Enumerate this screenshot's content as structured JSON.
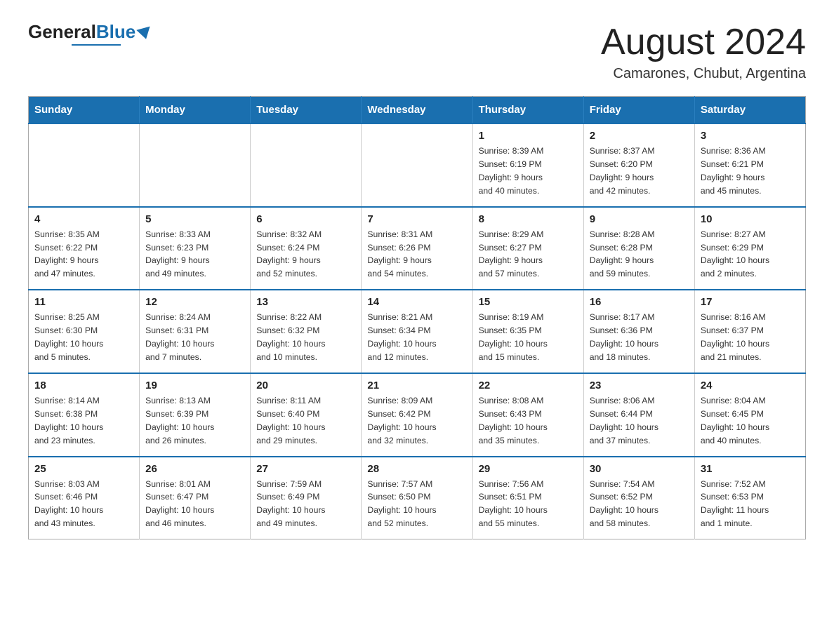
{
  "logo": {
    "general": "General",
    "blue": "Blue"
  },
  "title": "August 2024",
  "location": "Camarones, Chubut, Argentina",
  "weekdays": [
    "Sunday",
    "Monday",
    "Tuesday",
    "Wednesday",
    "Thursday",
    "Friday",
    "Saturday"
  ],
  "weeks": [
    [
      {
        "day": "",
        "info": ""
      },
      {
        "day": "",
        "info": ""
      },
      {
        "day": "",
        "info": ""
      },
      {
        "day": "",
        "info": ""
      },
      {
        "day": "1",
        "info": "Sunrise: 8:39 AM\nSunset: 6:19 PM\nDaylight: 9 hours\nand 40 minutes."
      },
      {
        "day": "2",
        "info": "Sunrise: 8:37 AM\nSunset: 6:20 PM\nDaylight: 9 hours\nand 42 minutes."
      },
      {
        "day": "3",
        "info": "Sunrise: 8:36 AM\nSunset: 6:21 PM\nDaylight: 9 hours\nand 45 minutes."
      }
    ],
    [
      {
        "day": "4",
        "info": "Sunrise: 8:35 AM\nSunset: 6:22 PM\nDaylight: 9 hours\nand 47 minutes."
      },
      {
        "day": "5",
        "info": "Sunrise: 8:33 AM\nSunset: 6:23 PM\nDaylight: 9 hours\nand 49 minutes."
      },
      {
        "day": "6",
        "info": "Sunrise: 8:32 AM\nSunset: 6:24 PM\nDaylight: 9 hours\nand 52 minutes."
      },
      {
        "day": "7",
        "info": "Sunrise: 8:31 AM\nSunset: 6:26 PM\nDaylight: 9 hours\nand 54 minutes."
      },
      {
        "day": "8",
        "info": "Sunrise: 8:29 AM\nSunset: 6:27 PM\nDaylight: 9 hours\nand 57 minutes."
      },
      {
        "day": "9",
        "info": "Sunrise: 8:28 AM\nSunset: 6:28 PM\nDaylight: 9 hours\nand 59 minutes."
      },
      {
        "day": "10",
        "info": "Sunrise: 8:27 AM\nSunset: 6:29 PM\nDaylight: 10 hours\nand 2 minutes."
      }
    ],
    [
      {
        "day": "11",
        "info": "Sunrise: 8:25 AM\nSunset: 6:30 PM\nDaylight: 10 hours\nand 5 minutes."
      },
      {
        "day": "12",
        "info": "Sunrise: 8:24 AM\nSunset: 6:31 PM\nDaylight: 10 hours\nand 7 minutes."
      },
      {
        "day": "13",
        "info": "Sunrise: 8:22 AM\nSunset: 6:32 PM\nDaylight: 10 hours\nand 10 minutes."
      },
      {
        "day": "14",
        "info": "Sunrise: 8:21 AM\nSunset: 6:34 PM\nDaylight: 10 hours\nand 12 minutes."
      },
      {
        "day": "15",
        "info": "Sunrise: 8:19 AM\nSunset: 6:35 PM\nDaylight: 10 hours\nand 15 minutes."
      },
      {
        "day": "16",
        "info": "Sunrise: 8:17 AM\nSunset: 6:36 PM\nDaylight: 10 hours\nand 18 minutes."
      },
      {
        "day": "17",
        "info": "Sunrise: 8:16 AM\nSunset: 6:37 PM\nDaylight: 10 hours\nand 21 minutes."
      }
    ],
    [
      {
        "day": "18",
        "info": "Sunrise: 8:14 AM\nSunset: 6:38 PM\nDaylight: 10 hours\nand 23 minutes."
      },
      {
        "day": "19",
        "info": "Sunrise: 8:13 AM\nSunset: 6:39 PM\nDaylight: 10 hours\nand 26 minutes."
      },
      {
        "day": "20",
        "info": "Sunrise: 8:11 AM\nSunset: 6:40 PM\nDaylight: 10 hours\nand 29 minutes."
      },
      {
        "day": "21",
        "info": "Sunrise: 8:09 AM\nSunset: 6:42 PM\nDaylight: 10 hours\nand 32 minutes."
      },
      {
        "day": "22",
        "info": "Sunrise: 8:08 AM\nSunset: 6:43 PM\nDaylight: 10 hours\nand 35 minutes."
      },
      {
        "day": "23",
        "info": "Sunrise: 8:06 AM\nSunset: 6:44 PM\nDaylight: 10 hours\nand 37 minutes."
      },
      {
        "day": "24",
        "info": "Sunrise: 8:04 AM\nSunset: 6:45 PM\nDaylight: 10 hours\nand 40 minutes."
      }
    ],
    [
      {
        "day": "25",
        "info": "Sunrise: 8:03 AM\nSunset: 6:46 PM\nDaylight: 10 hours\nand 43 minutes."
      },
      {
        "day": "26",
        "info": "Sunrise: 8:01 AM\nSunset: 6:47 PM\nDaylight: 10 hours\nand 46 minutes."
      },
      {
        "day": "27",
        "info": "Sunrise: 7:59 AM\nSunset: 6:49 PM\nDaylight: 10 hours\nand 49 minutes."
      },
      {
        "day": "28",
        "info": "Sunrise: 7:57 AM\nSunset: 6:50 PM\nDaylight: 10 hours\nand 52 minutes."
      },
      {
        "day": "29",
        "info": "Sunrise: 7:56 AM\nSunset: 6:51 PM\nDaylight: 10 hours\nand 55 minutes."
      },
      {
        "day": "30",
        "info": "Sunrise: 7:54 AM\nSunset: 6:52 PM\nDaylight: 10 hours\nand 58 minutes."
      },
      {
        "day": "31",
        "info": "Sunrise: 7:52 AM\nSunset: 6:53 PM\nDaylight: 11 hours\nand 1 minute."
      }
    ]
  ]
}
